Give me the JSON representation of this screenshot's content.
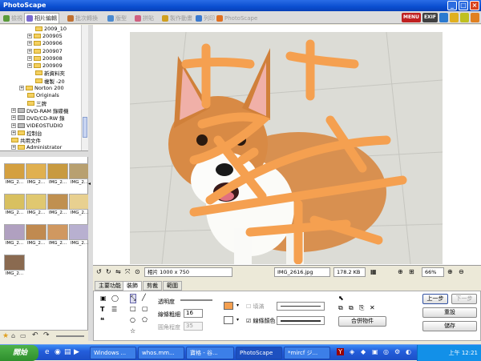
{
  "window": {
    "title": "PhotoScape"
  },
  "tabs": [
    {
      "label": "檢視",
      "color": "#5a9a3a"
    },
    {
      "label": "相片編輯",
      "color": "#7a6ad0"
    },
    {
      "label": "批次轉換",
      "color": "#c07030"
    },
    {
      "label": "版型",
      "color": "#4a8ad0"
    },
    {
      "label": "拼貼",
      "color": "#d06080"
    },
    {
      "label": "製作動畫",
      "color": "#d0a020"
    },
    {
      "label": "列印",
      "color": "#3a7ad0"
    },
    {
      "label": "PhotoScape",
      "color": "#e07020"
    }
  ],
  "right_buttons": {
    "menu": "MENU",
    "exif": "EXIF"
  },
  "tree": [
    {
      "label": "2009_10",
      "indent": 5,
      "type": "folder",
      "exp": ""
    },
    {
      "label": "200905",
      "indent": 4,
      "type": "folder",
      "exp": "+"
    },
    {
      "label": "200906",
      "indent": 4,
      "type": "folder",
      "exp": "+"
    },
    {
      "label": "200907",
      "indent": 4,
      "type": "folder",
      "exp": "+"
    },
    {
      "label": "200908",
      "indent": 4,
      "type": "folder",
      "exp": "+"
    },
    {
      "label": "200909",
      "indent": 4,
      "type": "folder",
      "exp": "+"
    },
    {
      "label": "新資料夾",
      "indent": 5,
      "type": "folder",
      "exp": ""
    },
    {
      "label": "複製 -20",
      "indent": 5,
      "type": "folder",
      "exp": ""
    },
    {
      "label": "Norton 200",
      "indent": 3,
      "type": "folder",
      "exp": "+"
    },
    {
      "label": "Originals",
      "indent": 4,
      "type": "folder",
      "exp": ""
    },
    {
      "label": "三牌",
      "indent": 4,
      "type": "folder",
      "exp": ""
    },
    {
      "label": "DVD-RAM 錄碟機",
      "indent": 2,
      "type": "drive",
      "exp": "+"
    },
    {
      "label": "DVD/CD-RW 錄",
      "indent": 2,
      "type": "drive",
      "exp": "+"
    },
    {
      "label": "VIDEOSTUDIO",
      "indent": 2,
      "type": "drive",
      "exp": "+"
    },
    {
      "label": "控制台",
      "indent": 2,
      "type": "folder",
      "exp": "+"
    },
    {
      "label": "共用文件",
      "indent": 2,
      "type": "folder",
      "exp": ""
    },
    {
      "label": "Administrator",
      "indent": 2,
      "type": "folder",
      "exp": "+"
    }
  ],
  "thumbnails": [
    {
      "cap": "IMG_2...",
      "color": "#d4a040"
    },
    {
      "cap": "IMG_2...",
      "color": "#e0b050"
    },
    {
      "cap": "IMG_2...",
      "color": "#c89a40"
    },
    {
      "cap": "IMG_2...",
      "color": "#b8a070"
    },
    {
      "cap": "IMG_2...",
      "color": "#d8c060"
    },
    {
      "cap": "IMG_2...",
      "color": "#e0c870"
    },
    {
      "cap": "IMG_2...",
      "color": "#c09050"
    },
    {
      "cap": "IMG_2...",
      "color": "#e8d090"
    },
    {
      "cap": "IMG_2...",
      "color": "#b0a0c0"
    },
    {
      "cap": "IMG_2...",
      "color": "#c08a50"
    },
    {
      "cap": "IMG_2...",
      "color": "#d09860"
    },
    {
      "cap": "IMG_2...",
      "color": "#b8b0d0"
    },
    {
      "cap": "IMG_2...",
      "color": "#8a6a50"
    }
  ],
  "infobar": {
    "size_label": "相片 1000 x 750",
    "filename": "IMG_2616.jpg",
    "filesize": "178.2 KB",
    "zoom": "66%"
  },
  "edit_tabs": [
    "主要功能",
    "裝飾",
    "剪裁",
    "範圍"
  ],
  "tool_panel": {
    "opacity_label": "透明度",
    "line_width_label": "線條粗細",
    "line_width_value": "16",
    "corner_label": "圓角程度",
    "corner_value": "35",
    "fill_label": "填滿",
    "outline_label": "線條顏色",
    "merge_btn": "合併物件",
    "stroke_color": "#f5a050"
  },
  "side_buttons": {
    "undo": "上一步",
    "redo": "下一步",
    "reset": "重設",
    "save": "儲存"
  },
  "taskbar": {
    "start": "開始",
    "tasks": [
      "Windows ...",
      "whos.mm...",
      "寶格 - 谷...",
      "PhotoScape",
      "*mircf ジ..."
    ],
    "clock": "上午 12:21"
  }
}
